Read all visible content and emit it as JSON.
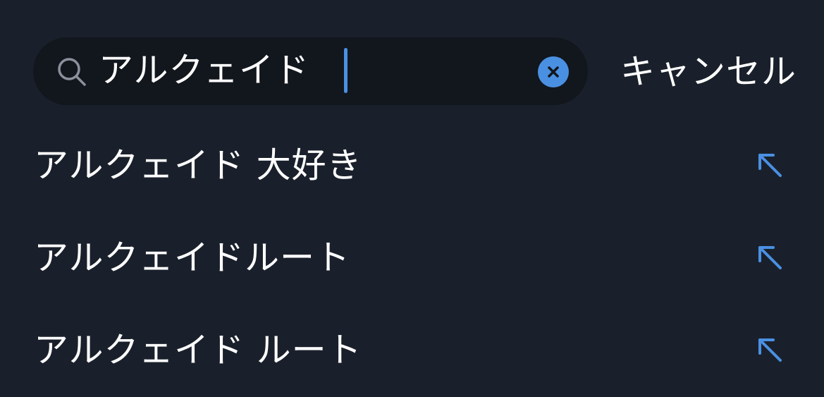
{
  "search": {
    "value": "アルクェイド",
    "clear_icon": "clear-icon",
    "search_icon": "search-icon"
  },
  "cancel_label": "キャンセル",
  "suggestions": [
    {
      "label": "アルクェイド 大好き",
      "icon": "arrow-up-left-icon"
    },
    {
      "label": "アルクェイドルート",
      "icon": "arrow-up-left-icon"
    },
    {
      "label": "アルクェイド ルート",
      "icon": "arrow-up-left-icon"
    }
  ],
  "colors": {
    "background": "#1a202b",
    "search_bar": "#12161d",
    "accent": "#4a90e2",
    "text": "#ffffff",
    "icon_muted": "#8a919c"
  }
}
